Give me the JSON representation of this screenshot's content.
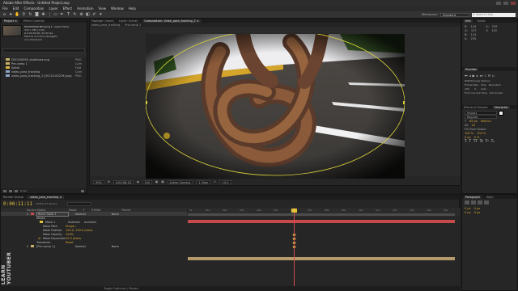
{
  "window": {
    "title": "Adobe After Effects - Untitled Project.aep"
  },
  "menu": [
    "File",
    "Edit",
    "Composition",
    "Layer",
    "Effect",
    "Animation",
    "View",
    "Window",
    "Help"
  ],
  "toolbar": {
    "tools": [
      "home-tool",
      "selection-tool",
      "hand-tool",
      "zoom-tool",
      "rotate-tool",
      "camera-tool",
      "pan-behind-tool",
      "mask-tool",
      "pen-tool",
      "type-tool",
      "brush-tool",
      "clone-tool",
      "eraser-tool",
      "roto-tool",
      "puppet-tool"
    ],
    "workspace_label": "Workspace:",
    "workspace_value": "Standard",
    "search_placeholder": "Search Help"
  },
  "project": {
    "tabs": [
      "Project ×",
      "Effect Controls"
    ],
    "file_name": "DSC000099.MOV.png ▾ , used 1 time",
    "file_info": [
      "320 x 180 (1.00)",
      "Δ 0:00:09:00, 25.00 fps",
      "Millions of Colors (Straight)",
      "non-interlaced"
    ],
    "items": [
      {
        "name": "DSC000099_stabilized.png",
        "type": "PNG",
        "color": "#c9b068"
      },
      {
        "name": "Pre-comp 1",
        "type": "Com",
        "color": "#c9b068"
      },
      {
        "name": "Solids",
        "type": "Fold",
        "color": "#d9b43a"
      },
      {
        "name": "video_para_tracking",
        "type": "Com",
        "color": "#8fa5c8"
      },
      {
        "name": "video_para_tracking_2 [00120-00239].png",
        "type": "PNG",
        "color": "#8fa5c8"
      }
    ]
  },
  "viewer": {
    "tabs": [
      "Footage: (none)",
      "Layer: (none)",
      "Composition: video_para_tracking_2 ×"
    ],
    "sub_tabs": [
      "video_para_tracking",
      "Pre-comp 1"
    ],
    "zoom": "50%",
    "timecode": "0:00:06:16",
    "resolution": "Full",
    "camera": "Active Camera",
    "views": "1 View",
    "offset": "+0.0"
  },
  "info_panel": {
    "tabs": [
      "Info",
      "Audio"
    ],
    "rows": [
      [
        "R:",
        "144",
        "X:",
        "239"
      ],
      [
        "G:",
        "137",
        "Y:",
        "152"
      ],
      [
        "B:",
        "114",
        ""
      ],
      [
        "A:",
        "255",
        ""
      ]
    ]
  },
  "preview_panel": {
    "tab": "Preview",
    "options_label": "RAM Preview Options",
    "frame_rate_label": "Frame Rate",
    "skip_label": "Skip",
    "resolution_label": "Resolution",
    "frame_rate": "(25)",
    "skip": "0",
    "resolution": "Auto",
    "from_current": "From Current Time",
    "full_screen": "Full Screen"
  },
  "effects_panel": {
    "tabs": [
      "Effects & Presets",
      "Character"
    ],
    "font": "Impact",
    "style": "Regular",
    "size": "65 px",
    "tracking": "20",
    "kerning": "Metrics",
    "stroke": "Fill Over Stroke",
    "scale_v": "100 %",
    "scale_h": "100 %",
    "baseline": "0 px",
    "tsume": "0 %"
  },
  "paragraph_panel": {
    "tabs": [
      "Paragraph",
      "Align"
    ],
    "values": [
      "0 px",
      "0 px",
      "0 px",
      "0 px"
    ]
  },
  "timeline": {
    "tabs": [
      "Render Queue",
      "video_para_tracking ×"
    ],
    "timecode": "0:00:11:11",
    "frame": "00286 (25.00 fps)",
    "columns": [
      "Source Name",
      "Mode",
      "T",
      "TrkMat",
      "Parent"
    ],
    "layers": [
      {
        "idx": "1",
        "name": "Black Solid 1",
        "color": "#c74a4a",
        "mode": "Normal",
        "parent": "None",
        "selected": true
      },
      {
        "idx": "",
        "name": "Masks",
        "color": "",
        "mode": "",
        "parent": ""
      },
      {
        "idx": "",
        "name": "Mask 1",
        "color": "#e2c03a",
        "mode": "Subtract",
        "inverted": "Inverted",
        "parent": ""
      },
      {
        "idx": "",
        "name": "Mask Path",
        "color": "",
        "value": "Shape..."
      },
      {
        "idx": "",
        "name": "Mask Feather",
        "color": "",
        "value": "150.0, 150.0 pixels"
      },
      {
        "idx": "",
        "name": "Mask Opacity",
        "color": "",
        "value": "100%"
      },
      {
        "idx": "",
        "name": "Mask Expansion",
        "color": "",
        "value": "15.0 pixels"
      },
      {
        "idx": "",
        "name": "Transform",
        "color": "",
        "value": "Reset"
      },
      {
        "idx": "2",
        "name": "[Pre-comp 1]",
        "color": "#c9b068",
        "mode": "Normal",
        "parent": "None"
      }
    ],
    "ruler_labels": [
      "0s",
      "01s",
      "02s",
      "03s",
      "04s",
      "05s",
      "06s",
      "07s",
      "08s",
      "09s",
      "10s",
      "11s",
      "12s",
      "13s",
      "14s",
      "15s"
    ],
    "toggle_label": "Toggle Switches / Modes"
  },
  "watermark": "LEARN YOUTUBER",
  "colors": {
    "accent": "#e2c03a",
    "layer_red": "#c74a4a",
    "layer_tan": "#b49a6a",
    "mask_path": "#d8d23a"
  }
}
